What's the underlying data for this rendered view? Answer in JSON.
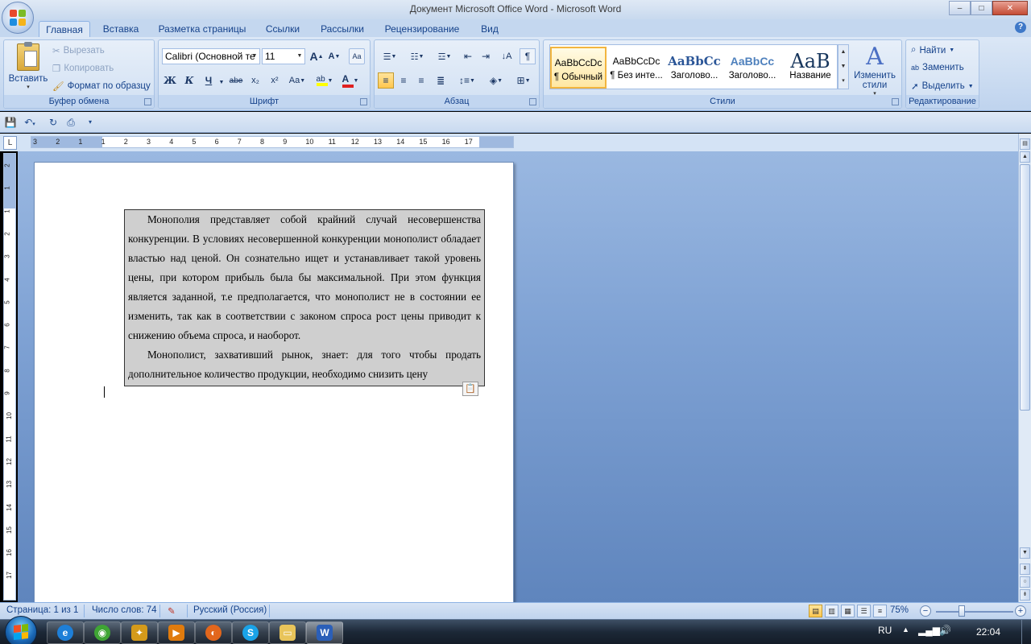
{
  "window": {
    "title": "Документ Microsoft Office Word - Microsoft Word",
    "min": "–",
    "max": "□",
    "close": "✕"
  },
  "tabs": [
    "Главная",
    "Вставка",
    "Разметка страницы",
    "Ссылки",
    "Рассылки",
    "Рецензирование",
    "Вид"
  ],
  "help": "?",
  "ribbon": {
    "clipboard": {
      "label": "Буфер обмена",
      "paste": "Вставить",
      "cut": "Вырезать",
      "copy": "Копировать",
      "format_painter": "Формат по образцу"
    },
    "font": {
      "label": "Шрифт",
      "font_name": "Calibri (Основной те",
      "font_size": "11",
      "bold": "Ж",
      "italic": "К",
      "underline": "Ч",
      "strike": "abe",
      "subscript": "x₂",
      "superscript": "x²",
      "change_case": "Aa",
      "grow": "A",
      "shrink": "A"
    },
    "paragraph": {
      "label": "Абзац"
    },
    "styles": {
      "label": "Стили",
      "items": [
        {
          "sample": "AaBbCcDc",
          "name": "¶ Обычный"
        },
        {
          "sample": "AaBbCcDc",
          "name": "¶ Без инте..."
        },
        {
          "sample": "AaBbCc",
          "name": "Заголово..."
        },
        {
          "sample": "AaBbCc",
          "name": "Заголово..."
        },
        {
          "sample": "AaB",
          "name": "Название"
        }
      ],
      "change": "Изменить стили"
    },
    "editing": {
      "label": "Редактирование",
      "find": "Найти",
      "replace": "Заменить",
      "select": "Выделить"
    }
  },
  "ruler": {
    "h_ticks": [
      "3",
      "2",
      "1",
      "1",
      "2",
      "3",
      "4",
      "5",
      "6",
      "7",
      "8",
      "9",
      "10",
      "11",
      "12",
      "13",
      "14",
      "15",
      "16",
      "17"
    ],
    "v_ticks": [
      "2",
      "1",
      "1",
      "2",
      "3",
      "4",
      "5",
      "6",
      "7",
      "8",
      "9",
      "10",
      "11",
      "12",
      "13",
      "14",
      "15",
      "16",
      "17"
    ]
  },
  "document": {
    "paragraphs": [
      "Монополия представляет собой крайний случай несовершенства конкуренции. В условиях  несовершенной конкуренции монополист обладает властью над ценой. Он сознательно ищет и устанавливает такой уровень цены, при котором прибыль была бы максимальной. При этом функция является заданной, т.е предполагается, что монополист не в состоянии ее изменить, так как в соответствии с законом  спроса рост цены приводит к снижению объема спроса, и наоборот.",
      "Монополист, захвативший рынок, знает: для того чтобы продать дополнительное количество  продукции, необходимо снизить цену"
    ]
  },
  "status": {
    "page": "Страница: 1 из 1",
    "words": "Число слов: 74",
    "language": "Русский (Россия)",
    "zoom": "75%",
    "zoom_level": 0.75
  },
  "taskbar": {
    "lang": "RU",
    "time": "22:04"
  },
  "colors": {
    "accent": "#15428b",
    "workspace": "#7fa2d4",
    "textbox": "#cfcfcf"
  }
}
